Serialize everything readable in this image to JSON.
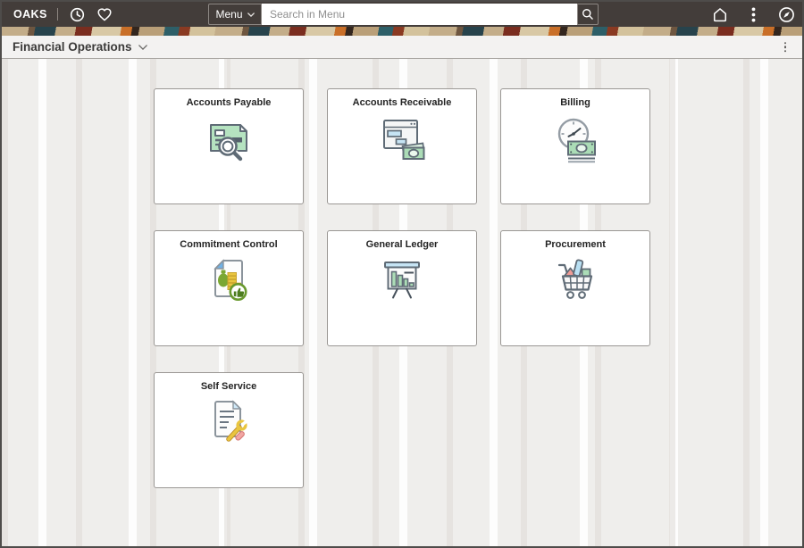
{
  "topbar": {
    "brand": "OAKS",
    "menu_button_label": "Menu",
    "search_placeholder": "Search in Menu",
    "icons": [
      "recent-items-icon",
      "favorites-icon",
      "search-icon",
      "home-icon",
      "actions-menu-icon",
      "navbar-compass-icon"
    ]
  },
  "page_header": {
    "title": "Financial Operations",
    "icons": [
      "chevron-down-icon",
      "kebab-menu-icon"
    ]
  },
  "tiles": [
    {
      "label": "Accounts Payable",
      "icon": "accounts-payable-icon"
    },
    {
      "label": "Accounts Receivable",
      "icon": "accounts-receivable-icon"
    },
    {
      "label": "Billing",
      "icon": "billing-icon"
    },
    {
      "label": "Commitment Control",
      "icon": "commitment-control-icon"
    },
    {
      "label": "General Ledger",
      "icon": "general-ledger-icon"
    },
    {
      "label": "Procurement",
      "icon": "procurement-icon"
    },
    {
      "label": "Self Service",
      "icon": "self-service-icon"
    }
  ],
  "colors": {
    "topbar_bg": "#433d3a",
    "header_bg": "#f3f2f1",
    "content_bg": "#efeeec",
    "tile_border": "#9a9794",
    "accent_mint": "#abdcb6",
    "accent_blue": "#c6e4f4",
    "accent_gold": "#e9c53f",
    "accent_pink": "#ef9b95",
    "accent_olive": "#79a62f"
  }
}
